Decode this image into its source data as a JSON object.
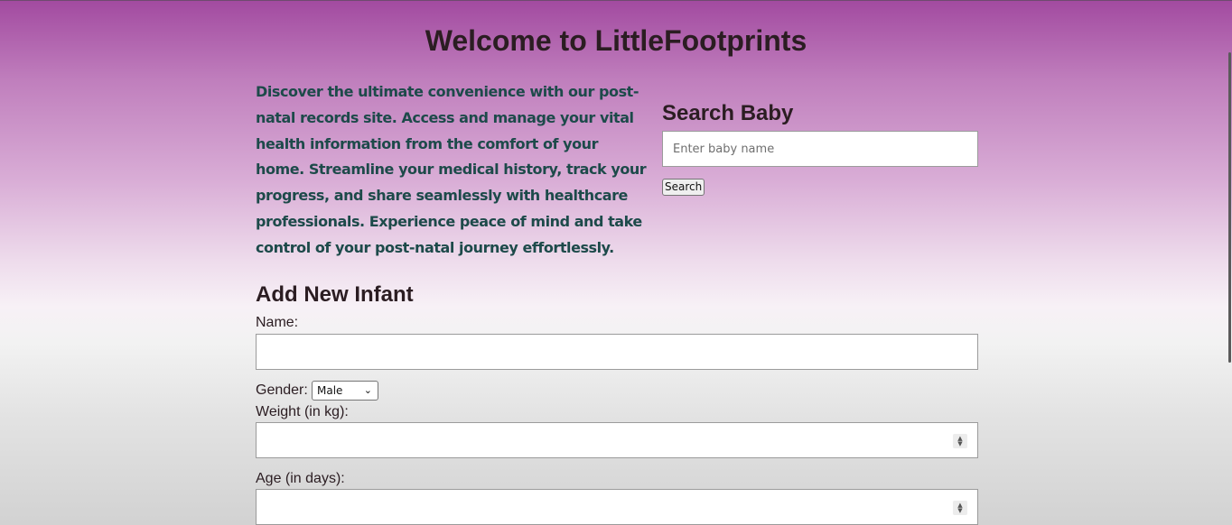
{
  "page": {
    "title": "Welcome to LittleFootprints",
    "intro": "Discover the ultimate convenience with our post-natal records site. Access and manage your vital health information from the comfort of your home. Streamline your medical history, track your progress, and share seamlessly with healthcare professionals. Experience peace of mind and take control of your post-natal journey effortlessly."
  },
  "search": {
    "title": "Search Baby",
    "placeholder": "Enter baby name",
    "button_label": "Search"
  },
  "add_infant": {
    "title": "Add New Infant",
    "name_label": "Name:",
    "gender_label": "Gender:",
    "gender_selected": "Male",
    "weight_label": "Weight (in kg):",
    "age_label": "Age (in days):"
  },
  "icons": {
    "select_arrow": "chevron-down-icon",
    "spinner": "number-stepper-icon"
  },
  "colors": {
    "gradient_top": "#a24aa0",
    "intro_text": "#1d4a4a",
    "heading_text": "#2b1d22"
  }
}
